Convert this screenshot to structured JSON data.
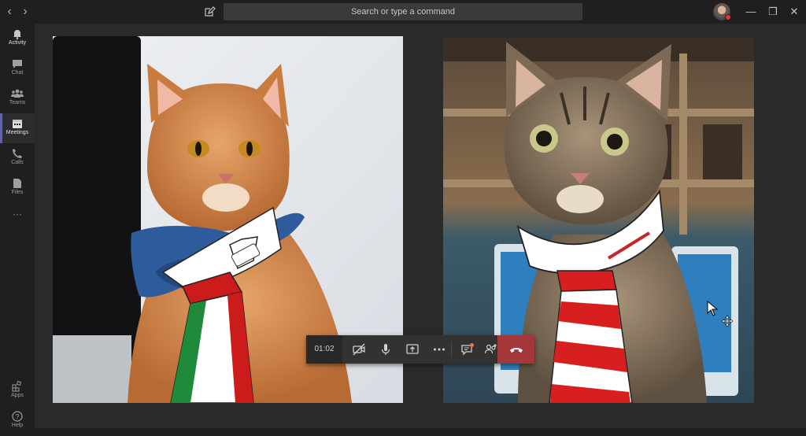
{
  "titlebar": {
    "search_placeholder": "Search or type a command",
    "back_glyph": "‹",
    "forward_glyph": "›",
    "minimize_glyph": "—",
    "restore_glyph": "❐",
    "close_glyph": "✕"
  },
  "rail": {
    "items": [
      {
        "label": "Activity",
        "icon": "bell-icon"
      },
      {
        "label": "Chat",
        "icon": "chat-icon"
      },
      {
        "label": "Teams",
        "icon": "teams-icon"
      },
      {
        "label": "Meetings",
        "icon": "calendar-icon",
        "active": true
      },
      {
        "label": "Calls",
        "icon": "phone-icon"
      },
      {
        "label": "Files",
        "icon": "file-icon"
      }
    ],
    "more_glyph": "···",
    "apps_label": "Apps",
    "help_label": "Help"
  },
  "call": {
    "timer": "01:02",
    "controls": [
      "camera-off-icon",
      "microphone-icon",
      "share-screen-icon",
      "more-icon",
      "chat-icon",
      "participants-icon",
      "hang-up-icon"
    ]
  },
  "colors": {
    "accent": "#6264a7",
    "hangup": "#a4373a",
    "status_busy": "#e0383f"
  }
}
